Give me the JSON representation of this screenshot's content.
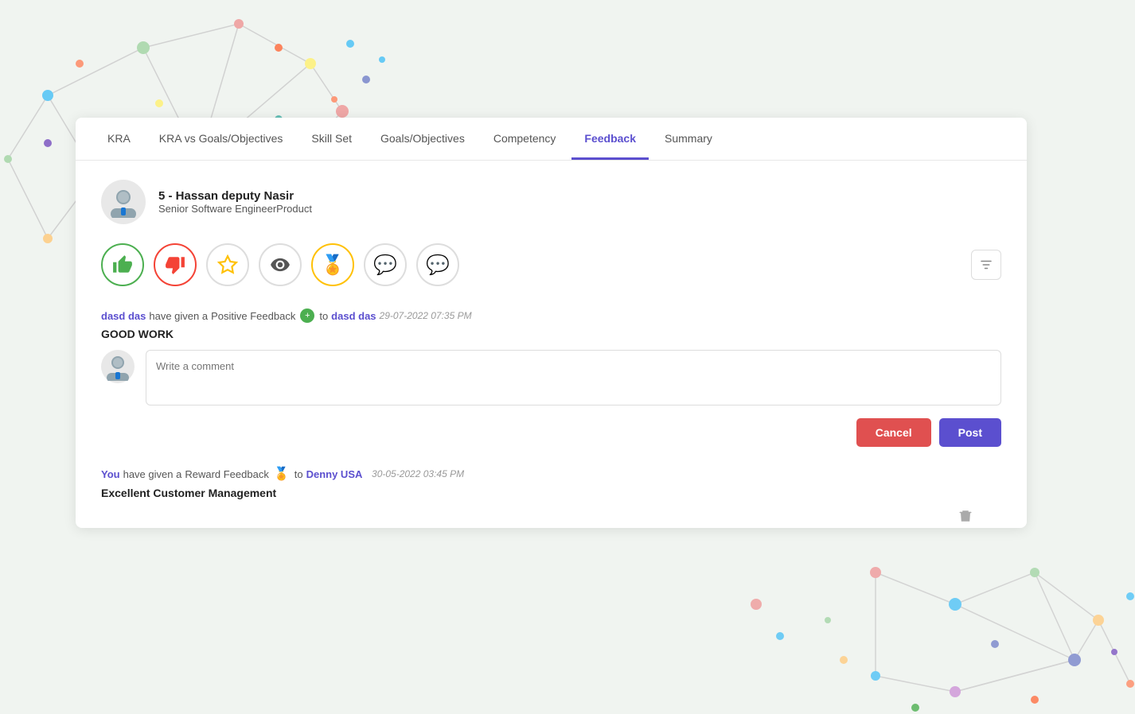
{
  "tabs": [
    {
      "label": "KRA",
      "active": false
    },
    {
      "label": "KRA vs Goals/Objectives",
      "active": false
    },
    {
      "label": "Skill Set",
      "active": false
    },
    {
      "label": "Goals/Objectives",
      "active": false
    },
    {
      "label": "Competency",
      "active": false
    },
    {
      "label": "Feedback",
      "active": true
    },
    {
      "label": "Summary",
      "active": false
    }
  ],
  "user": {
    "name": "5 - Hassan deputy Nasir",
    "title": "Senior Software EngineerProduct"
  },
  "feedback1": {
    "sender": "dasd das",
    "type": "Positive Feedback",
    "recipient": "dasd das",
    "timestamp": "29-07-2022 07:35 PM",
    "text": "GOOD WORK"
  },
  "comment": {
    "placeholder": "Write a comment"
  },
  "buttons": {
    "cancel": "Cancel",
    "post": "Post"
  },
  "feedback2": {
    "sender": "You",
    "type": "Reward Feedback",
    "recipient": "Denny USA",
    "timestamp": "30-05-2022 03:45 PM",
    "text": "Excellent Customer Management"
  }
}
